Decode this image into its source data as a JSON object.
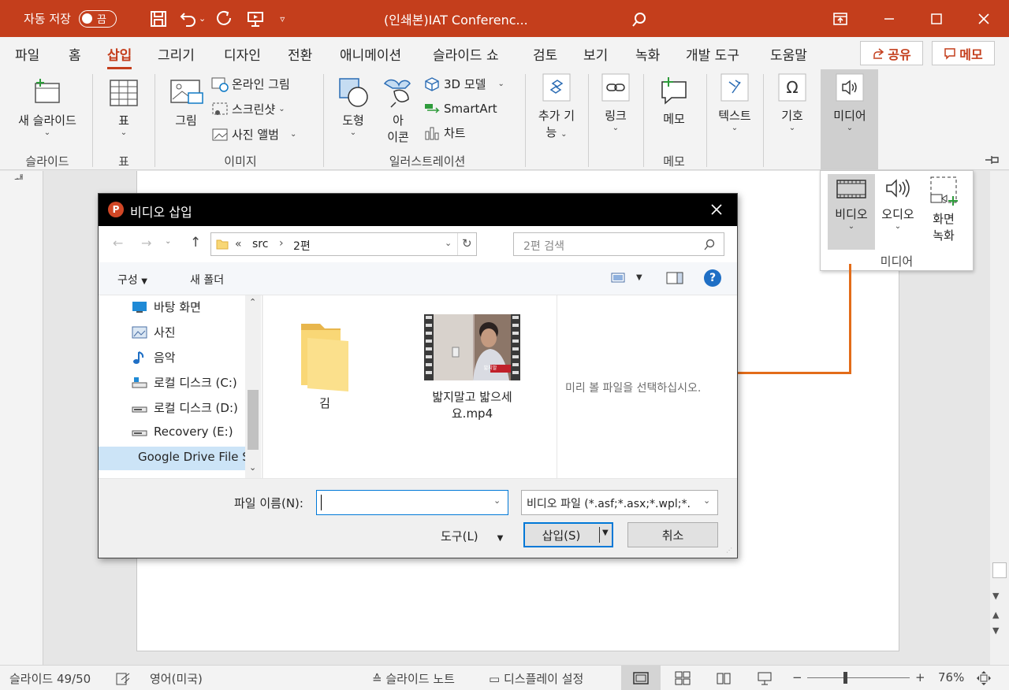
{
  "titlebar": {
    "autosave_label": "자동 저장",
    "toggle_state": "끔",
    "doc_title": "(인쇄본)IAT Conferenc...",
    "accent": "#c43e1c"
  },
  "menu": {
    "tabs": [
      "파일",
      "홈",
      "삽입",
      "그리기",
      "디자인",
      "전환",
      "애니메이션",
      "슬라이드 쇼",
      "검토",
      "보기",
      "녹화",
      "개발 도구",
      "도움말"
    ],
    "share_label": "공유",
    "memo_label": "메모"
  },
  "ribbon": {
    "new_slide": "새 슬라이드",
    "table": "표",
    "image": "그림",
    "online_image": "온라인 그림",
    "screenshot": "스크린샷",
    "photo_album": "사진 앨범",
    "shapes": "도형",
    "icons_line1": "아",
    "icons_line2": "이콘",
    "model3d": "3D 모델",
    "smartart": "SmartArt",
    "chart": "차트",
    "addins_line1": "추가 기",
    "addins_line2": "능",
    "link": "링크",
    "memo": "메모",
    "text": "텍스트",
    "symbol": "기호",
    "media": "미디어",
    "groups": {
      "slides": "슬라이드",
      "tables": "표",
      "images": "이미지",
      "illustrations": "일러스트레이션",
      "comments": "메모"
    }
  },
  "media_dropdown": {
    "video": "비디오",
    "audio": "오디오",
    "screen_rec_line1": "화면",
    "screen_rec_line2": "녹화",
    "group_label": "미디어"
  },
  "thumb_label": "ᅫ",
  "dialog": {
    "title": "비디오 삽입",
    "breadcrumb_prefix": "«",
    "breadcrumb": [
      "src",
      "2편"
    ],
    "search_placeholder": "2편 검색",
    "organize": "구성",
    "new_folder": "새 폴더",
    "nav_items": [
      "바탕 화면",
      "사진",
      "음악",
      "로컬 디스크 (C:)",
      "로컬 디스크 (D:)",
      "Recovery (E:)",
      "Google Drive File Stream (G:)"
    ],
    "files": [
      {
        "name": "김",
        "kind": "folder"
      },
      {
        "name_line1": "밟지말고 밟으세",
        "name_line2": "요.mp4",
        "kind": "video",
        "thumb_caption": "밟지말"
      }
    ],
    "preview_msg": "미리 볼 파일을 선택하십시오.",
    "filename_label": "파일 이름(N):",
    "filename_value": "",
    "filetype": "비디오 파일 (*.asf;*.asx;*.wpl;*.",
    "tools": "도구(L)",
    "insert": "삽입(S)",
    "cancel": "취소"
  },
  "status": {
    "slide_counter": "슬라이드 49/50",
    "language": "영어(미국)",
    "notes": "슬라이드 노트",
    "display_settings": "디스플레이 설정",
    "zoom": "76%"
  },
  "arrow_color": "#e36c19"
}
